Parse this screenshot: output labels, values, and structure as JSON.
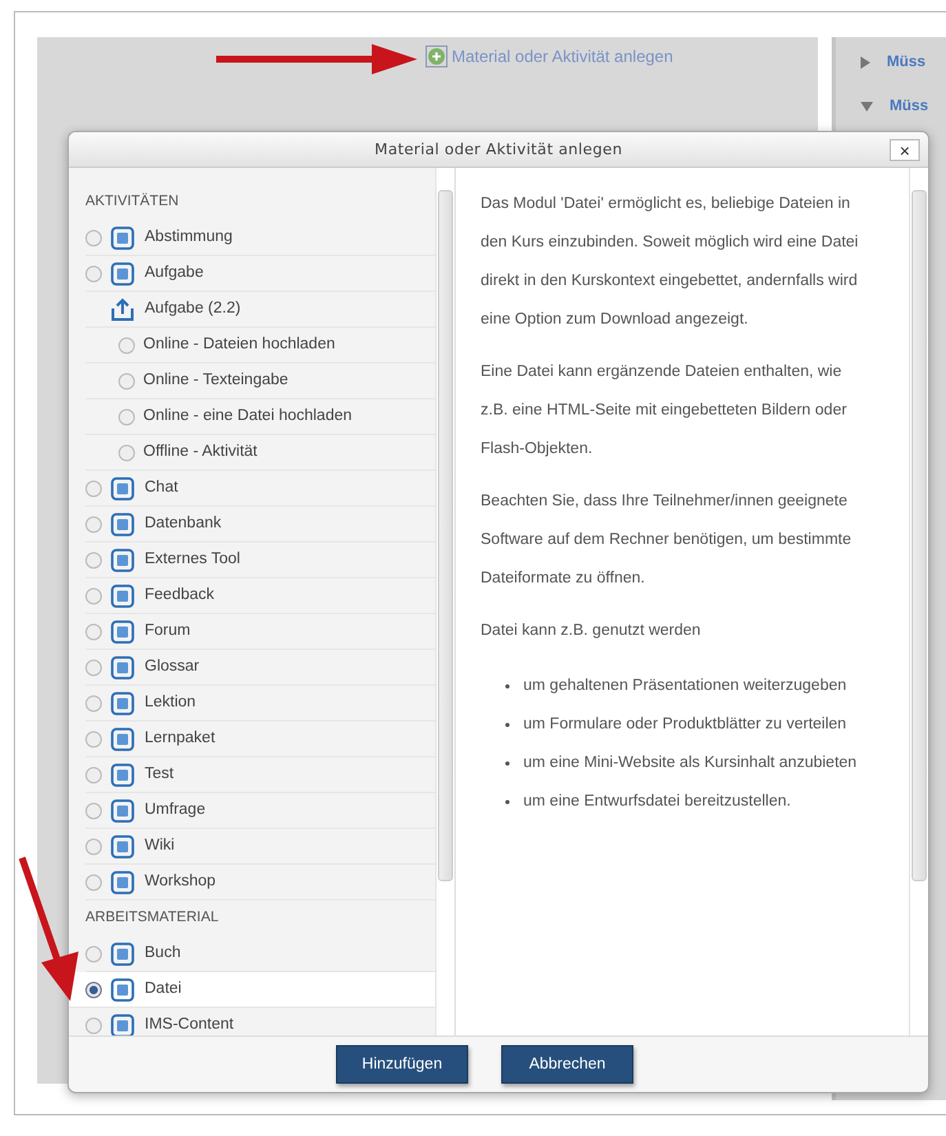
{
  "page_link": {
    "label": "Material oder Aktivität anlegen"
  },
  "side_links": [
    {
      "label": "Müss",
      "expanded": false
    },
    {
      "label": "Müss",
      "expanded": true
    }
  ],
  "dialog": {
    "title": "Material oder Aktivität anlegen",
    "close": "×",
    "items": [
      {
        "kind": "heading",
        "label": "AKTIVITÄTEN"
      },
      {
        "kind": "module",
        "label": "Abstimmung",
        "selected": false
      },
      {
        "kind": "module",
        "label": "Aufgabe",
        "selected": false
      },
      {
        "kind": "group",
        "label": "Aufgabe (2.2)"
      },
      {
        "kind": "option",
        "label": "Online - Dateien hochladen",
        "selected": false
      },
      {
        "kind": "option",
        "label": "Online - Texteingabe",
        "selected": false
      },
      {
        "kind": "option",
        "label": "Online - eine Datei hochladen",
        "selected": false
      },
      {
        "kind": "option",
        "label": "Offline - Aktivität",
        "selected": false
      },
      {
        "kind": "module",
        "label": "Chat",
        "selected": false
      },
      {
        "kind": "module",
        "label": "Datenbank",
        "selected": false
      },
      {
        "kind": "module",
        "label": "Externes Tool",
        "selected": false
      },
      {
        "kind": "module",
        "label": "Feedback",
        "selected": false
      },
      {
        "kind": "module",
        "label": "Forum",
        "selected": false
      },
      {
        "kind": "module",
        "label": "Glossar",
        "selected": false
      },
      {
        "kind": "module",
        "label": "Lektion",
        "selected": false
      },
      {
        "kind": "module",
        "label": "Lernpaket",
        "selected": false
      },
      {
        "kind": "module",
        "label": "Test",
        "selected": false
      },
      {
        "kind": "module",
        "label": "Umfrage",
        "selected": false
      },
      {
        "kind": "module",
        "label": "Wiki",
        "selected": false
      },
      {
        "kind": "module",
        "label": "Workshop",
        "selected": false
      },
      {
        "kind": "heading",
        "label": "ARBEITSMATERIAL"
      },
      {
        "kind": "module",
        "label": "Buch",
        "selected": false
      },
      {
        "kind": "module",
        "label": "Datei",
        "selected": true
      },
      {
        "kind": "module",
        "label": "IMS-Content",
        "selected": false
      }
    ],
    "description": {
      "paragraphs": [
        "Das Modul 'Datei' ermöglicht es, beliebige Dateien in den Kurs einzubinden. Soweit möglich wird eine Datei direkt in den Kurskontext eingebettet, andernfalls wird eine Option zum Download angezeigt.",
        "Eine Datei kann ergänzende Dateien enthalten, wie z.B. eine HTML-Seite mit eingebetteten Bildern oder Flash-Objekten.",
        "Beachten Sie, dass Ihre Teilnehmer/innen geeignete Software auf dem Rechner benötigen, um bestimmte Dateiformate zu öffnen.",
        "Datei kann z.B. genutzt werden"
      ],
      "bullets": [
        "um gehaltenen Präsentationen weiterzugeben",
        "um Formulare oder Produktblätter zu verteilen",
        "um eine Mini-Website als Kursinhalt anzubieten",
        "um eine Entwurfsdatei bereitzustellen."
      ]
    },
    "buttons": [
      "Hinzufügen",
      "Abbrechen"
    ]
  }
}
